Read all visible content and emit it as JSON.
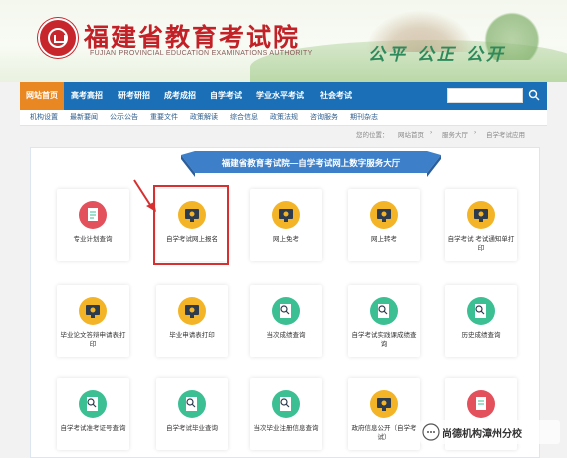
{
  "header": {
    "title": "福建省教育考试院",
    "subtitle": "FUJIAN PROVINCIAL EDUCATION EXAMINATIONS AUTHORITY",
    "slogan": "公平 公正 公开"
  },
  "nav": {
    "items": [
      "网站首页",
      "高考高招",
      "研考研招",
      "成考成招",
      "自学考试",
      "学业水平考试",
      "社会考试"
    ],
    "active_index": 0,
    "search_placeholder": ""
  },
  "subnav": {
    "items": [
      "机构设置",
      "最新要闻",
      "公示公告",
      "重要文件",
      "政策解读",
      "综合信息",
      "政策法规",
      "咨询服务",
      "期刊杂志"
    ]
  },
  "breadcrumb": {
    "label": "您的位置：",
    "items": [
      "网站首页",
      "服务大厅",
      "自学考试应用"
    ]
  },
  "panel": {
    "title": "福建省教育考试院—自学考试网上数字服务大厅"
  },
  "tiles": [
    {
      "label": "专业计划查询",
      "color": "red",
      "icon": "clipboard-icon"
    },
    {
      "label": "自学考试网上报名",
      "color": "yellow",
      "icon": "monitor-icon"
    },
    {
      "label": "网上免考",
      "color": "yellow",
      "icon": "monitor-icon"
    },
    {
      "label": "网上转考",
      "color": "yellow",
      "icon": "monitor-icon"
    },
    {
      "label": "自学考试 考试通知单打印",
      "color": "yellow",
      "icon": "monitor-icon"
    },
    {
      "label": "毕业论文答辩申请表打印",
      "color": "yellow",
      "icon": "monitor-icon"
    },
    {
      "label": "毕业申请表打印",
      "color": "yellow",
      "icon": "monitor-icon"
    },
    {
      "label": "当次成绩查询",
      "color": "teal",
      "icon": "search-doc-icon"
    },
    {
      "label": "自学考试实践课成绩查询",
      "color": "teal",
      "icon": "search-doc-icon"
    },
    {
      "label": "历史成绩查询",
      "color": "teal",
      "icon": "search-doc-icon"
    },
    {
      "label": "自学考试准考证号查询",
      "color": "teal",
      "icon": "search-doc-icon"
    },
    {
      "label": "自学考试毕业查询",
      "color": "teal",
      "icon": "search-doc-icon"
    },
    {
      "label": "当次毕业注册信息查询",
      "color": "teal",
      "icon": "search-doc-icon"
    },
    {
      "label": "政府信息公开（自学考试）",
      "color": "yellow",
      "icon": "monitor-icon"
    },
    {
      "label": "",
      "color": "red",
      "icon": "clipboard-icon"
    }
  ],
  "watermark": {
    "text": "尚德机构漳州分校"
  },
  "colors": {
    "nav_bg": "#1a6fb6",
    "nav_active": "#e98822",
    "title_red": "#c12127",
    "highlight": "#d73030"
  }
}
